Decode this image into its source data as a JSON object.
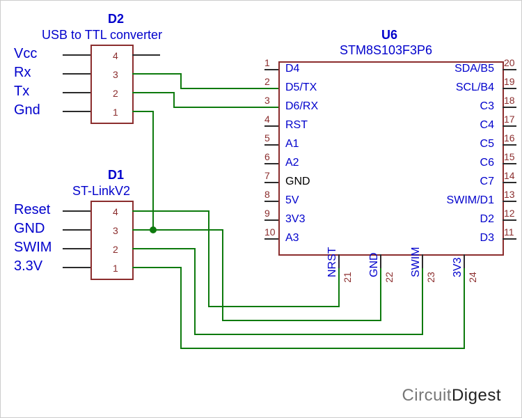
{
  "d2": {
    "ref": "D2",
    "value": "USB to TTL converter",
    "pins": [
      "4",
      "3",
      "2",
      "1"
    ],
    "signals": [
      "Vcc",
      "Rx",
      "Tx",
      "Gnd"
    ]
  },
  "d1": {
    "ref": "D1",
    "value": "ST-LinkV2",
    "pins": [
      "4",
      "3",
      "2",
      "1"
    ],
    "signals": [
      "Reset",
      "GND",
      "SWIM",
      "3.3V"
    ]
  },
  "u6": {
    "ref": "U6",
    "value": "STM8S103F3P6",
    "left_pins": [
      {
        "n": "1",
        "l": "D4"
      },
      {
        "n": "2",
        "l": "D5/TX"
      },
      {
        "n": "3",
        "l": "D6/RX"
      },
      {
        "n": "4",
        "l": "RST"
      },
      {
        "n": "5",
        "l": "A1"
      },
      {
        "n": "6",
        "l": "A2"
      },
      {
        "n": "7",
        "l": "GND"
      },
      {
        "n": "8",
        "l": "5V"
      },
      {
        "n": "9",
        "l": "3V3"
      },
      {
        "n": "10",
        "l": "A3"
      }
    ],
    "right_pins": [
      {
        "n": "20",
        "l": "SDA/B5"
      },
      {
        "n": "19",
        "l": "SCL/B4"
      },
      {
        "n": "18",
        "l": "C3"
      },
      {
        "n": "17",
        "l": "C4"
      },
      {
        "n": "16",
        "l": "C5"
      },
      {
        "n": "15",
        "l": "C6"
      },
      {
        "n": "14",
        "l": "C7"
      },
      {
        "n": "13",
        "l": "SWIM/D1"
      },
      {
        "n": "12",
        "l": "D2"
      },
      {
        "n": "11",
        "l": "D3"
      }
    ],
    "bottom_pins": [
      {
        "n": "21",
        "l": "NRST"
      },
      {
        "n": "22",
        "l": "GND"
      },
      {
        "n": "23",
        "l": "SWIM"
      },
      {
        "n": "24",
        "l": "3V3"
      }
    ]
  },
  "branding": {
    "text1": "Circuit",
    "text2": "Digest"
  }
}
